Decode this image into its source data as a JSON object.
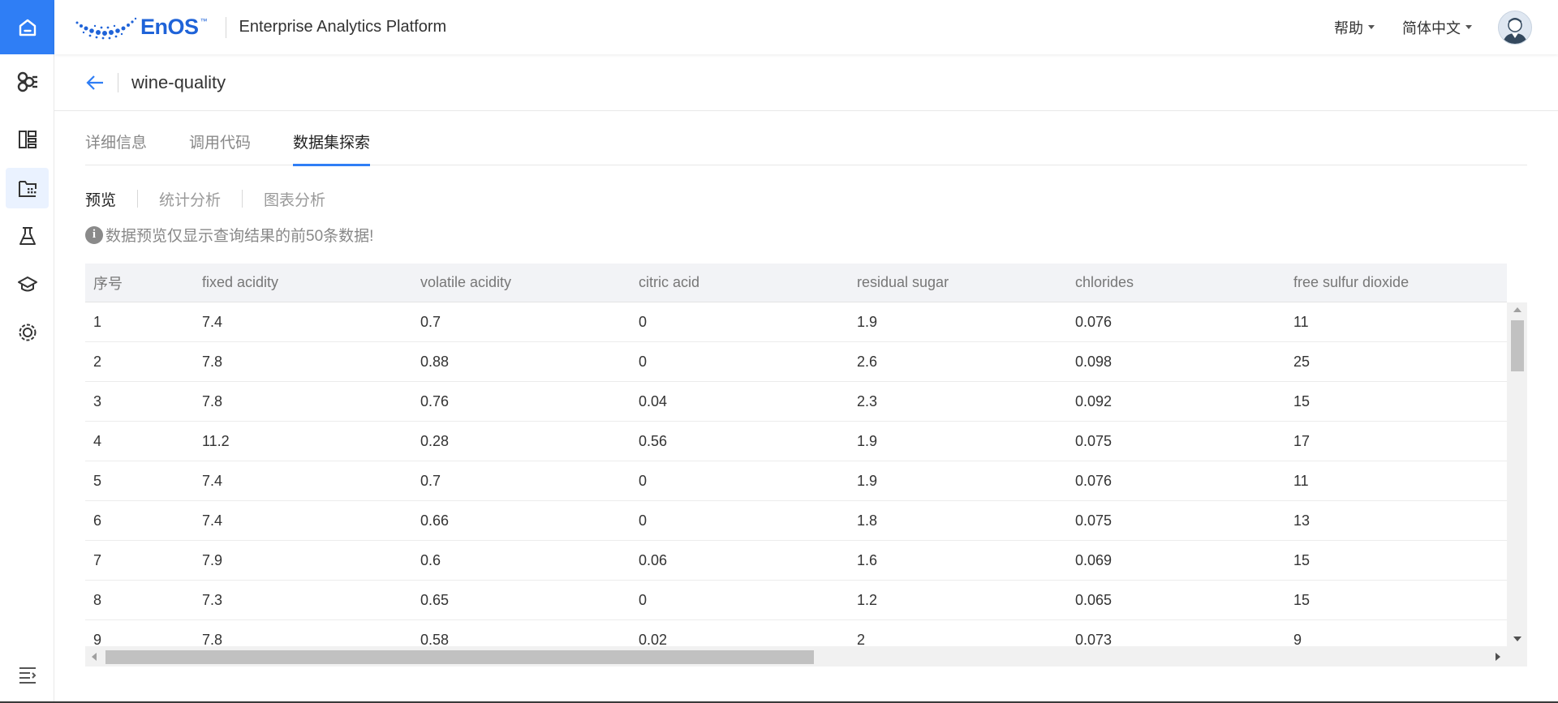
{
  "app": {
    "brand": "EnOS",
    "brand_tm": "™",
    "title": "Enterprise Analytics Platform",
    "accent_color": "#2f7ef5"
  },
  "header": {
    "help_label": "帮助",
    "language_label": "简体中文"
  },
  "sidebar": {
    "items": [
      {
        "name": "home",
        "icon": "home-icon"
      },
      {
        "name": "model-hub",
        "icon": "network-icon"
      },
      {
        "name": "dashboard",
        "icon": "layout-icon"
      },
      {
        "name": "dataset",
        "icon": "dataset-icon",
        "active": true
      },
      {
        "name": "lab",
        "icon": "flask-icon"
      },
      {
        "name": "publish",
        "icon": "cap-icon"
      },
      {
        "name": "settings",
        "icon": "gear-icon"
      },
      {
        "name": "collapse",
        "icon": "menu-collapse-icon"
      }
    ]
  },
  "page": {
    "title": "wine-quality",
    "tabs": [
      {
        "label": "详细信息"
      },
      {
        "label": "调用代码"
      },
      {
        "label": "数据集探索",
        "active": true
      }
    ],
    "subtabs": [
      {
        "label": "预览",
        "active": true
      },
      {
        "label": "统计分析"
      },
      {
        "label": "图表分析"
      }
    ],
    "notice": "数据预览仅显示查询结果的前50条数据!"
  },
  "table": {
    "columns": [
      "序号",
      "fixed acidity",
      "volatile acidity",
      "citric acid",
      "residual sugar",
      "chlorides",
      "free sulfur dioxide"
    ],
    "rows": [
      [
        "1",
        "7.4",
        "0.7",
        "0",
        "1.9",
        "0.076",
        "11"
      ],
      [
        "2",
        "7.8",
        "0.88",
        "0",
        "2.6",
        "0.098",
        "25"
      ],
      [
        "3",
        "7.8",
        "0.76",
        "0.04",
        "2.3",
        "0.092",
        "15"
      ],
      [
        "4",
        "11.2",
        "0.28",
        "0.56",
        "1.9",
        "0.075",
        "17"
      ],
      [
        "5",
        "7.4",
        "0.7",
        "0",
        "1.9",
        "0.076",
        "11"
      ],
      [
        "6",
        "7.4",
        "0.66",
        "0",
        "1.8",
        "0.075",
        "13"
      ],
      [
        "7",
        "7.9",
        "0.6",
        "0.06",
        "1.6",
        "0.069",
        "15"
      ],
      [
        "8",
        "7.3",
        "0.65",
        "0",
        "1.2",
        "0.065",
        "15"
      ],
      [
        "9",
        "7.8",
        "0.58",
        "0.02",
        "2",
        "0.073",
        "9"
      ]
    ]
  }
}
